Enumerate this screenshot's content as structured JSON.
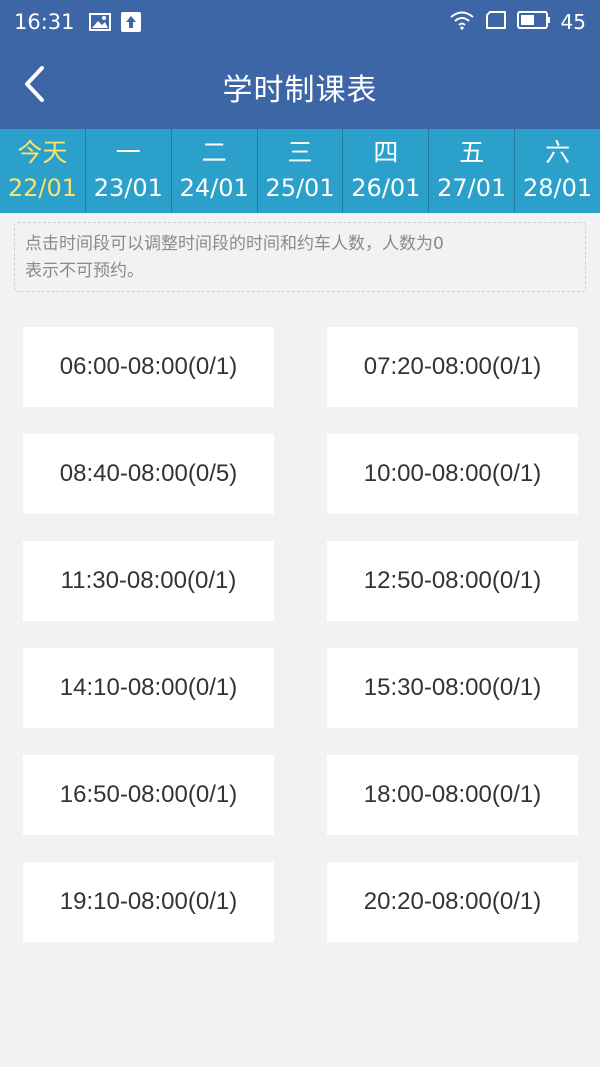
{
  "status_bar": {
    "time": "16:31",
    "battery": "45",
    "icons": [
      "image-icon",
      "upload-icon",
      "wifi-icon",
      "sim-icon",
      "battery-icon"
    ]
  },
  "header": {
    "title": "学时制课表",
    "back_icon": "chevron-left-icon"
  },
  "days": [
    {
      "name": "今天",
      "date": "22/01",
      "active": true
    },
    {
      "name": "一",
      "date": "23/01",
      "active": false
    },
    {
      "name": "二",
      "date": "24/01",
      "active": false
    },
    {
      "name": "三",
      "date": "25/01",
      "active": false
    },
    {
      "name": "四",
      "date": "26/01",
      "active": false
    },
    {
      "name": "五",
      "date": "27/01",
      "active": false
    },
    {
      "name": "六",
      "date": "28/01",
      "active": false
    }
  ],
  "hint": {
    "line1": "点击时间段可以调整时间段的时间和约车人数，人数为0",
    "line2": "表示不可预约。"
  },
  "slots": [
    "06:00-08:00(0/1)",
    "07:20-08:00(0/1)",
    "08:40-08:00(0/5)",
    "10:00-08:00(0/1)",
    "11:30-08:00(0/1)",
    "12:50-08:00(0/1)",
    "14:10-08:00(0/1)",
    "15:30-08:00(0/1)",
    "16:50-08:00(0/1)",
    "18:00-08:00(0/1)",
    "19:10-08:00(0/1)",
    "20:20-08:00(0/1)"
  ],
  "colors": {
    "header": "#3d66a6",
    "day_strip": "#2aa0cb",
    "active_day": "#f7e46a"
  }
}
